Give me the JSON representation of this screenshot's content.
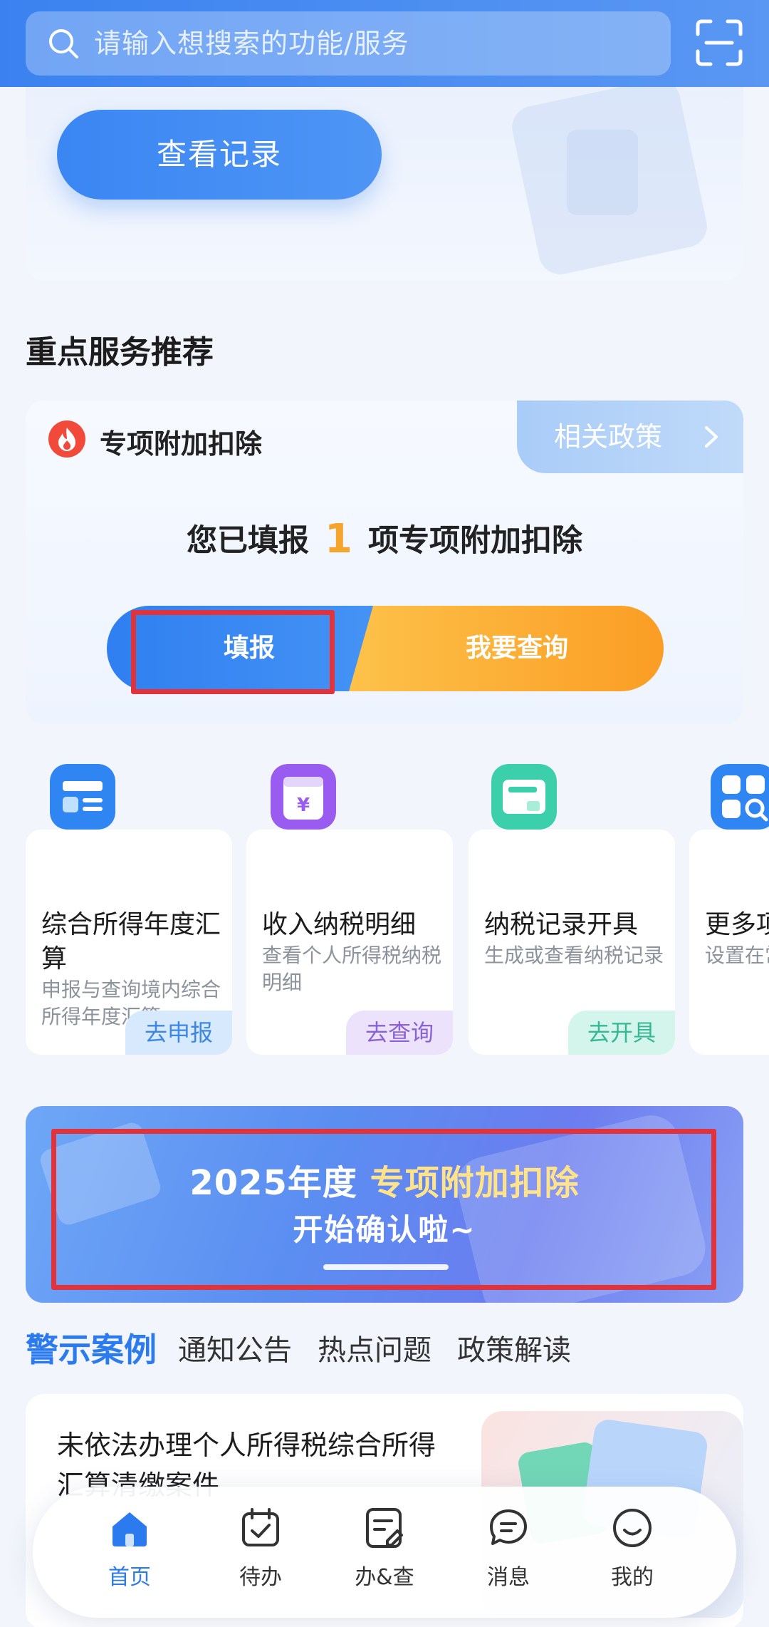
{
  "search": {
    "placeholder": "请输入想搜索的功能/服务",
    "scan_icon": "scan-icon",
    "search_icon": "search-icon"
  },
  "records": {
    "button_label": "查看记录"
  },
  "section": {
    "title": "重点服务推荐"
  },
  "deduction": {
    "title": "专项附加扣除",
    "icon": "fire-icon",
    "policy_label": "相关政策",
    "summary_prefix": "您已填报",
    "count": "1",
    "summary_suffix": "项专项附加扣除",
    "fill_label": "填报",
    "query_label": "我要查询"
  },
  "services": [
    {
      "icon": "annual-tax-icon",
      "title": "综合所得年度汇算",
      "desc": "申报与查询境内综合所得年度汇算",
      "action": "去申报",
      "color": "#2f86f3",
      "action_bg": "#d6e9fd",
      "action_color": "#3d86e6"
    },
    {
      "icon": "income-detail-icon",
      "title": "收入纳税明细",
      "desc": "查看个人所得税纳税明细",
      "action": "去查询",
      "color": "#9a5cf0",
      "action_bg": "#ece2fb",
      "action_color": "#8b62d6"
    },
    {
      "icon": "tax-record-icon",
      "title": "纳税记录开具",
      "desc": "生成或查看纳税记录",
      "action": "去开具",
      "color": "#3ccfab",
      "action_bg": "#d4f5ec",
      "action_color": "#37b894"
    },
    {
      "icon": "more-services-icon",
      "title": "更多项",
      "desc": "设置在常用功",
      "action": "",
      "color": "#2f86f3",
      "action_bg": "#ffffff",
      "action_color": "#3d86e6"
    }
  ],
  "banner": {
    "year": "2025年度",
    "highlight": "专项附加扣除",
    "subtitle": "开始确认啦~"
  },
  "tabs": [
    "警示案例",
    "通知公告",
    "热点问题",
    "政策解读"
  ],
  "case": {
    "title": "未依法办理个人所得税综合所得汇算清缴案件"
  },
  "nav": [
    {
      "label": "首页",
      "icon": "home-icon",
      "active": true
    },
    {
      "label": "待办",
      "icon": "calendar-check-icon",
      "active": false
    },
    {
      "label": "办&查",
      "icon": "document-edit-icon",
      "active": false
    },
    {
      "label": "消息",
      "icon": "message-icon",
      "active": false
    },
    {
      "label": "我的",
      "icon": "smile-icon",
      "active": false
    }
  ],
  "colors": {
    "primary": "#3b82f0",
    "accent_orange": "#fb9d24",
    "highlight_red": "#e0333b"
  }
}
